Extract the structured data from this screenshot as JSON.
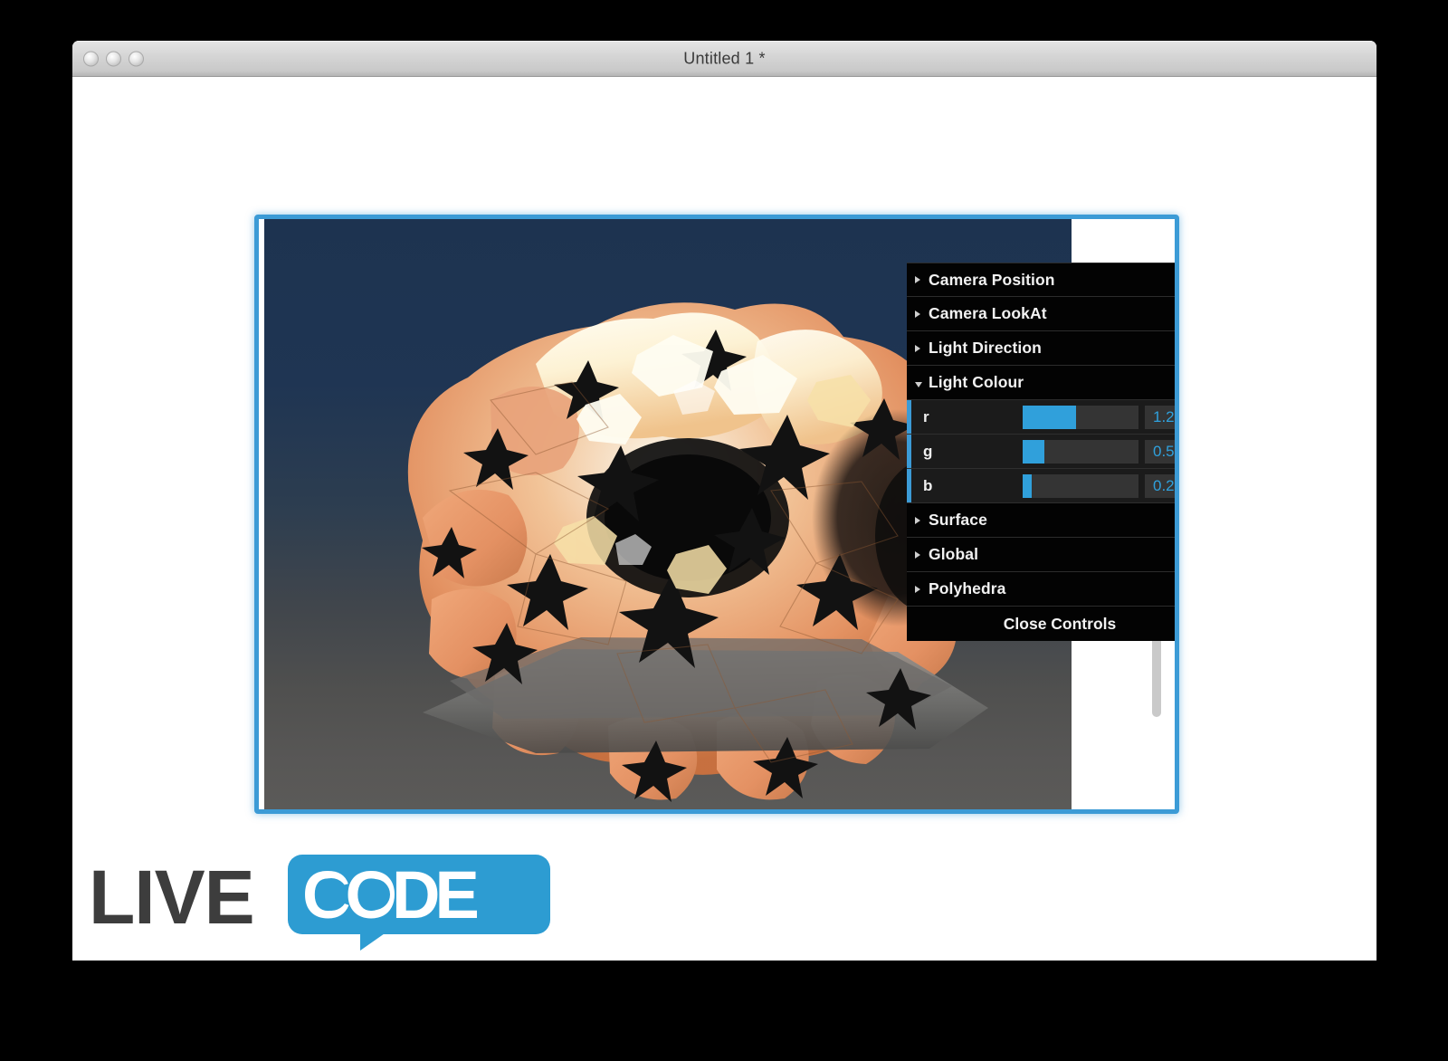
{
  "window": {
    "title": "Untitled 1 *",
    "traffic_lights": [
      "close-button",
      "minimize-button",
      "zoom-button"
    ]
  },
  "controls_panel": {
    "sections": [
      {
        "label": "Camera Position",
        "expanded": false
      },
      {
        "label": "Camera LookAt",
        "expanded": false
      },
      {
        "label": "Light Direction",
        "expanded": false
      },
      {
        "label": "Light Colour",
        "expanded": true
      }
    ],
    "light_colour_sliders": [
      {
        "name": "r",
        "value": "1.2",
        "fill_percent": 46
      },
      {
        "name": "g",
        "value": "0.5",
        "fill_percent": 19
      },
      {
        "name": "b",
        "value": "0.2",
        "fill_percent": 8
      }
    ],
    "sections_after": [
      {
        "label": "Surface",
        "expanded": false
      },
      {
        "label": "Global",
        "expanded": false
      },
      {
        "label": "Polyhedra",
        "expanded": false
      }
    ],
    "close_button_label": "Close Controls"
  },
  "logo": {
    "word_dark": "LIVE",
    "word_light": "CODE"
  },
  "colors": {
    "accent_blue": "#3c9bd6",
    "slider_blue": "#30a0db",
    "value_text_blue": "#2fa1dd",
    "panel_black": "#030303",
    "slider_row": "#1b1b1b",
    "slider_track": "#343434",
    "logo_dark": "#3d3d3d",
    "viewport_top": "#1d3350",
    "viewport_bottom": "#5b5a58"
  }
}
